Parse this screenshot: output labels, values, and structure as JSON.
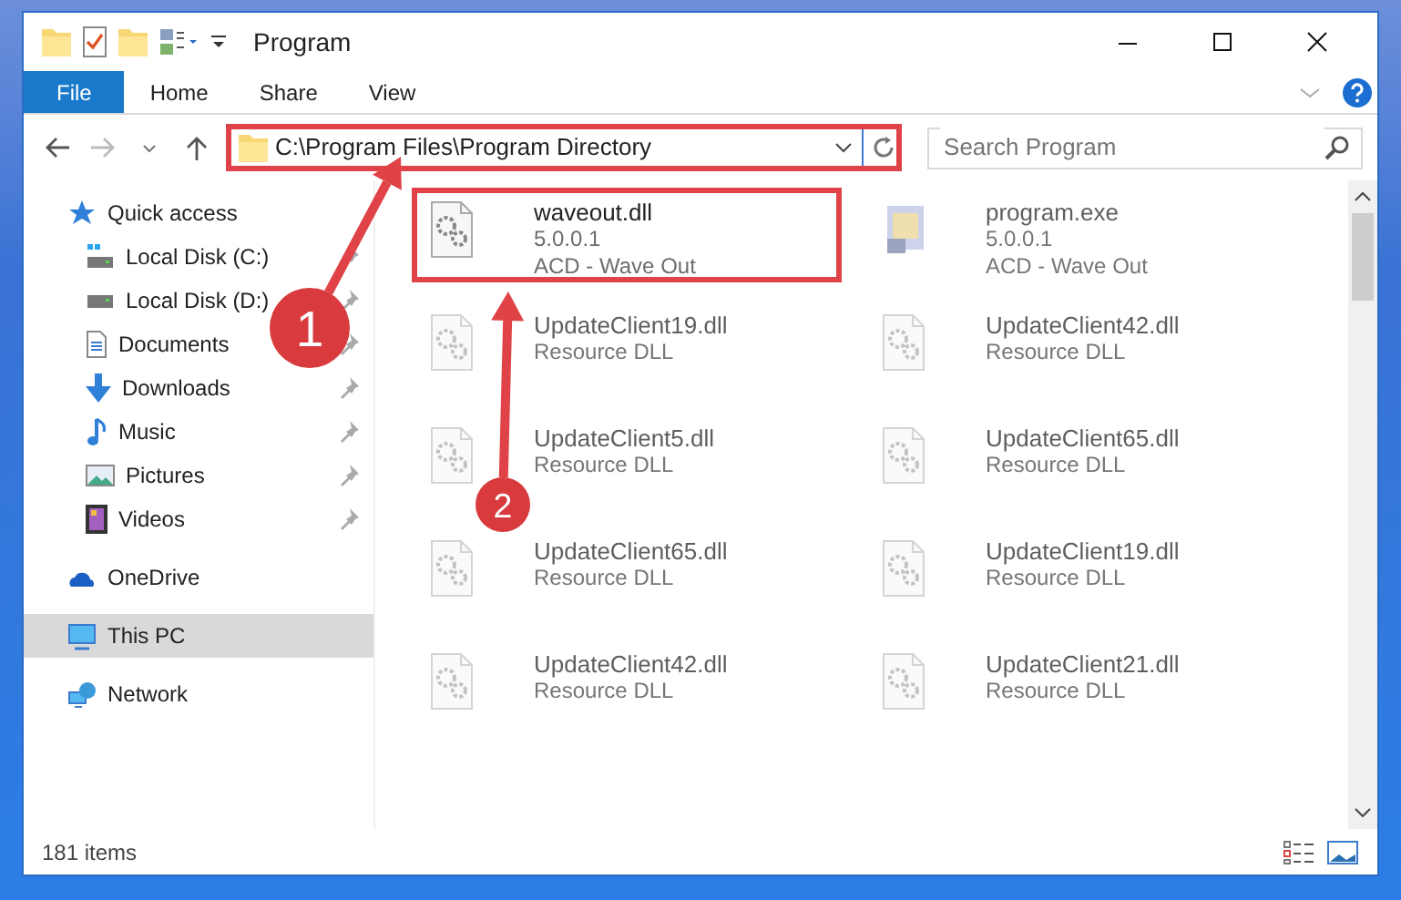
{
  "window": {
    "title": "Program"
  },
  "ribbon_tabs": [
    {
      "label": "File",
      "selected": true
    },
    {
      "label": "Home",
      "selected": false
    },
    {
      "label": "Share",
      "selected": false
    },
    {
      "label": "View",
      "selected": false
    }
  ],
  "address": {
    "path": "C:\\Program Files\\Program Directory",
    "highlighted": true
  },
  "search": {
    "placeholder": "Search Program"
  },
  "sidebar": {
    "items": [
      {
        "label": "Quick access",
        "kind": "quick",
        "selected": false,
        "pinned": false,
        "children": [
          {
            "label": "Local Disk (C:)",
            "kind": "diskc",
            "selected": false,
            "pinned": true
          },
          {
            "label": "Local Disk (D:)",
            "kind": "disk",
            "selected": false,
            "pinned": true
          },
          {
            "label": "Documents",
            "kind": "documents",
            "selected": false,
            "pinned": true
          },
          {
            "label": "Downloads",
            "kind": "downloads",
            "selected": false,
            "pinned": true
          },
          {
            "label": "Music",
            "kind": "music",
            "selected": false,
            "pinned": true
          },
          {
            "label": "Pictures",
            "kind": "pictures",
            "selected": false,
            "pinned": true
          },
          {
            "label": "Videos",
            "kind": "videos",
            "selected": false,
            "pinned": true
          }
        ]
      },
      {
        "label": "OneDrive",
        "kind": "cloud",
        "selected": false,
        "pinned": false
      },
      {
        "label": "This PC",
        "kind": "pc",
        "selected": true,
        "pinned": false
      },
      {
        "label": "Network",
        "kind": "network",
        "selected": false,
        "pinned": false
      }
    ]
  },
  "files": [
    {
      "name": "waveout.dll",
      "lines": [
        "5.0.0.1",
        "ACD - Wave Out"
      ],
      "kind": "dll",
      "highlighted": true,
      "dimmed": false
    },
    {
      "name": "program.exe",
      "lines": [
        "5.0.0.1",
        "ACD - Wave Out"
      ],
      "kind": "exe",
      "highlighted": false,
      "dimmed": true
    },
    {
      "name": "UpdateClient19.dll",
      "lines": [
        "Resource DLL"
      ],
      "kind": "dll",
      "highlighted": false,
      "dimmed": true
    },
    {
      "name": "UpdateClient42.dll",
      "lines": [
        "Resource DLL"
      ],
      "kind": "dll",
      "highlighted": false,
      "dimmed": true
    },
    {
      "name": "UpdateClient5.dll",
      "lines": [
        "Resource DLL"
      ],
      "kind": "dll",
      "highlighted": false,
      "dimmed": true
    },
    {
      "name": "UpdateClient65.dll",
      "lines": [
        "Resource DLL"
      ],
      "kind": "dll",
      "highlighted": false,
      "dimmed": true
    },
    {
      "name": "UpdateClient65.dll",
      "lines": [
        "Resource DLL"
      ],
      "kind": "dll",
      "highlighted": false,
      "dimmed": true
    },
    {
      "name": "UpdateClient19.dll",
      "lines": [
        "Resource DLL"
      ],
      "kind": "dll",
      "highlighted": false,
      "dimmed": true
    },
    {
      "name": "UpdateClient42.dll",
      "lines": [
        "Resource DLL"
      ],
      "kind": "dll",
      "highlighted": false,
      "dimmed": true
    },
    {
      "name": "UpdateClient21.dll",
      "lines": [
        "Resource DLL"
      ],
      "kind": "dll",
      "highlighted": false,
      "dimmed": true
    }
  ],
  "status_bar": {
    "count": "181 items"
  },
  "annotations": [
    {
      "number": "1"
    },
    {
      "number": "2"
    }
  ]
}
